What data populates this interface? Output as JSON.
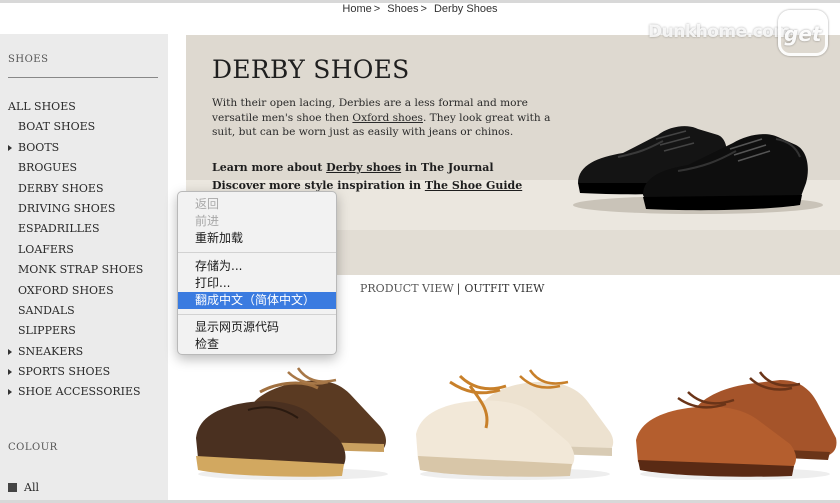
{
  "breadcrumb": {
    "home": "Home",
    "shoes": "Shoes",
    "current": "Derby Shoes",
    "separator": ">"
  },
  "watermark": {
    "text": "Dunkhome.com",
    "logo": "get"
  },
  "sidebar": {
    "heading": "SHOES",
    "items": [
      {
        "label": "ALL SHOES",
        "kind": "all"
      },
      {
        "label": "BOAT SHOES",
        "kind": "sub"
      },
      {
        "label": "BOOTS",
        "kind": "tri"
      },
      {
        "label": "BROGUES",
        "kind": "sub"
      },
      {
        "label": "DERBY SHOES",
        "kind": "sub"
      },
      {
        "label": "DRIVING SHOES",
        "kind": "sub"
      },
      {
        "label": "ESPADRILLES",
        "kind": "sub"
      },
      {
        "label": "LOAFERS",
        "kind": "sub"
      },
      {
        "label": "MONK STRAP SHOES",
        "kind": "sub"
      },
      {
        "label": "OXFORD SHOES",
        "kind": "sub"
      },
      {
        "label": "SANDALS",
        "kind": "sub"
      },
      {
        "label": "SLIPPERS",
        "kind": "sub"
      },
      {
        "label": "SNEAKERS",
        "kind": "tri"
      },
      {
        "label": "SPORTS SHOES",
        "kind": "tri"
      },
      {
        "label": "SHOE ACCESSORIES",
        "kind": "tri"
      }
    ],
    "colour_heading": "COLOUR",
    "colour_all": "All"
  },
  "hero": {
    "title": "DERBY SHOES",
    "intro_before": "With their open lacing, Derbies are a less formal and more versatile men's shoe then ",
    "intro_link": "Oxford shoes",
    "intro_after": ". They look great with a suit, but can be worn just as easily with jeans or chinos.",
    "learn_before": "Learn more about ",
    "learn_link": "Derby shoes",
    "learn_after": " in The Journal",
    "discover_before": "Discover more style inspiration in ",
    "discover_link": "The Shoe Guide"
  },
  "view_toggle": {
    "product_view": "PRODUCT VIEW",
    "separator": "|",
    "outfit_view": "OUTFIT VIEW"
  },
  "context_menu": {
    "items": [
      {
        "label": "返回",
        "enabled": false
      },
      {
        "label": "前进",
        "enabled": false
      },
      {
        "label": "重新加载",
        "enabled": true
      },
      {
        "label": "存储为...",
        "enabled": true
      },
      {
        "label": "打印...",
        "enabled": true
      },
      {
        "label": "翻成中文（简体中文）",
        "enabled": true,
        "highlighted": true
      },
      {
        "label": "显示网页源代码",
        "enabled": true
      },
      {
        "label": "检查",
        "enabled": true
      }
    ]
  },
  "colors": {
    "sidebar_bg": "#ebebeb",
    "hero_bg": "#ded9d0",
    "menu_highlight": "#3a7be0"
  }
}
